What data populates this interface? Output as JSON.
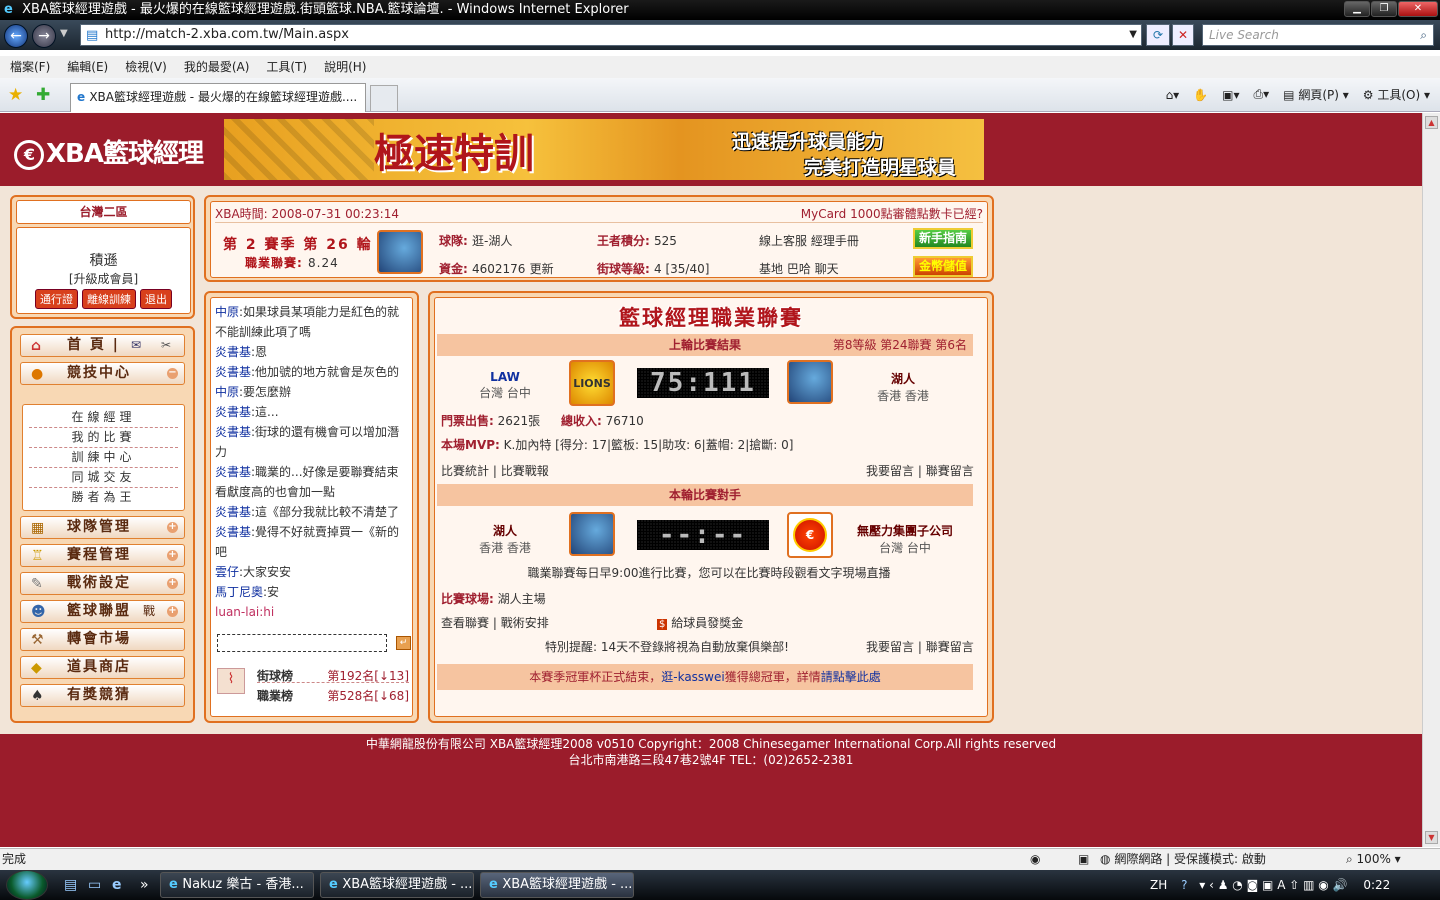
{
  "window": {
    "title": "XBA籃球經理遊戲 - 最火爆的在線籃球經理遊戲.街頭籃球.NBA.籃球論壇. - Windows Internet Explorer"
  },
  "browser": {
    "url": "http://match-2.xba.com.tw/Main.aspx",
    "search_placeholder": "Live Search",
    "menu": [
      "檔案(F)",
      "編輯(E)",
      "檢視(V)",
      "我的最愛(A)",
      "工具(T)",
      "說明(H)"
    ],
    "tab_title": "XBA籃球經理遊戲 - 最火爆的在線籃球經理遊戲....",
    "page_menu": "網頁(P)",
    "tools_menu": "工具(O)"
  },
  "site": {
    "logo": "XBA籃球經理",
    "banner": {
      "title": "極速特訓",
      "line1": "迅速提升球員能力",
      "line2": "完美打造明星球員"
    }
  },
  "left": {
    "region": "台灣二區",
    "username": "積遜",
    "role": "[升級成會員]",
    "buttons": [
      "通行證",
      "離線訓練",
      "退出"
    ],
    "menu": [
      {
        "label": "首 頁 |",
        "icon": "home-icon"
      },
      {
        "label": "競技中心",
        "icon": "basketball-icon"
      },
      {
        "label": "球隊管理",
        "icon": "team-icon"
      },
      {
        "label": "賽程管理",
        "icon": "trophy-icon"
      },
      {
        "label": "戰術設定",
        "icon": "tactics-icon"
      },
      {
        "label": "籃球聯盟",
        "icon": "league-icon",
        "extra": "戰"
      },
      {
        "label": "轉會市場",
        "icon": "hammer-icon"
      },
      {
        "label": "道具商店",
        "icon": "shop-icon"
      },
      {
        "label": "有獎競猜",
        "icon": "spade-icon"
      }
    ],
    "submenu": [
      "在線經理",
      "我的比賽",
      "訓練中心",
      "同城交友",
      "勝者為王"
    ]
  },
  "status_panel": {
    "time_label": "XBA時間:",
    "time": "2008-07-31 00:23:14",
    "marquee": "MyCard 1000點審體點數卡已經?",
    "season": "第 2 賽季 第 26 輪",
    "pro_label": "職業聯賽:",
    "pro_value": "8.24",
    "team_label": "球隊:",
    "team_value": "逛-湖人",
    "funds_label": "資金:",
    "funds_value": "4602176",
    "update": "更新",
    "king_label": "王者積分:",
    "king_value": "525",
    "street_label": "街球等級:",
    "street_value": "4 [35/40]",
    "links1": "線上客服 經理手冊",
    "links2": "基地 巴哈 聊天",
    "newbie": "新手指南",
    "deposit": "金幣儲值"
  },
  "chat": {
    "messages": [
      {
        "name": "中原",
        "text": ":如果球員某項能力是紅色的就不能訓練此項了嗎",
        "red": false
      },
      {
        "name": "炎書基",
        "text": ":恩",
        "red": false
      },
      {
        "name": "炎書基",
        "text": ":他加號的地方就會是灰色的",
        "red": false
      },
      {
        "name": "中原",
        "text": ":要怎麼辦",
        "red": false
      },
      {
        "name": "炎書基",
        "text": ":這...",
        "red": false
      },
      {
        "name": "炎書基",
        "text": ":街球的還有機會可以增加潛力",
        "red": false
      },
      {
        "name": "炎書基",
        "text": ":職業的...好像是要聯賽結束看獻度高的也會加一點",
        "red": false
      },
      {
        "name": "炎書基",
        "text": ":這《部分我就比較不清楚了",
        "red": false
      },
      {
        "name": "炎書基",
        "text": ":覺得不好就賣掉買一《新的吧",
        "red": false
      },
      {
        "name": "雲仔",
        "text": ":大家安安",
        "red": false
      },
      {
        "name": "馬丁尼奧",
        "text": ":安",
        "red": false
      },
      {
        "name": "luan-lai",
        "text": ":hi",
        "red": true
      }
    ],
    "ranks": [
      {
        "label": "街球榜",
        "value": "第192名[↓13]"
      },
      {
        "label": "職業榜",
        "value": "第528名[↓68]"
      }
    ]
  },
  "game": {
    "title": "籃球經理職業聯賽",
    "last_header": "上輪比賽結果",
    "last_level": "第8等級 第24聯賽 第6名",
    "last_home": {
      "name": "LAW",
      "loc": "台灣 台中"
    },
    "last_away": {
      "name": "湖人",
      "loc": "香港 香港"
    },
    "last_score": "75:111",
    "ticket_label": "門票出售:",
    "ticket_value": "2621張",
    "income_label": "總收入:",
    "income_value": "76710",
    "mvp_label": "本場MVP:",
    "mvp_value": "K.加內特 [得分: 17|籃板: 15|助攻: 6|蓋帽: 2|搶斷: 0]",
    "stats_link": "比賽統計",
    "report_link": "比賽戰報",
    "msg_link": "我要留言",
    "league_msg_link": "聯賽留言",
    "next_header": "本輪比賽對手",
    "next_home": {
      "name": "湖人",
      "loc": "香港 香港"
    },
    "next_away": {
      "name": "無壓力集團子公司",
      "loc": "台灣 台中"
    },
    "next_score": "--:--",
    "schedule_note": "職業聯賽每日早9:00進行比賽，您可以在比賽時段觀看文字現場直播",
    "venue_label": "比賽球場:",
    "venue_value": "湖人主場",
    "view_league": "查看聯賽",
    "tactics": "戰術安排",
    "bonus": "給球員發獎金",
    "warning": "特別提醒: 14天不登錄將視為自動放棄俱樂部!",
    "notice_pre": "本賽季冠軍杯正式結束，",
    "notice_champ": "逛-kasswei",
    "notice_mid": "獲得總冠軍，詳情",
    "notice_link": "請點擊此處"
  },
  "footer": {
    "line1": "中華網龍股份有限公司 XBA籃球經理2008 v0510    Copyright：2008 Chinesegamer International Corp.All rights reserved",
    "line2": "台北市南港路三段47巷2號4F TEL：(02)2652-2381"
  },
  "statusbar": {
    "left": "完成",
    "zone": "網際網路 | 受保護模式: 啟動",
    "zoom": "100%"
  },
  "taskbar": {
    "tasks": [
      "Nakuz 樂古 - 香港...",
      "XBA籃球經理遊戲 - ...",
      "XBA籃球經理遊戲 - ..."
    ],
    "lang": "ZH",
    "clock": "0:22"
  }
}
